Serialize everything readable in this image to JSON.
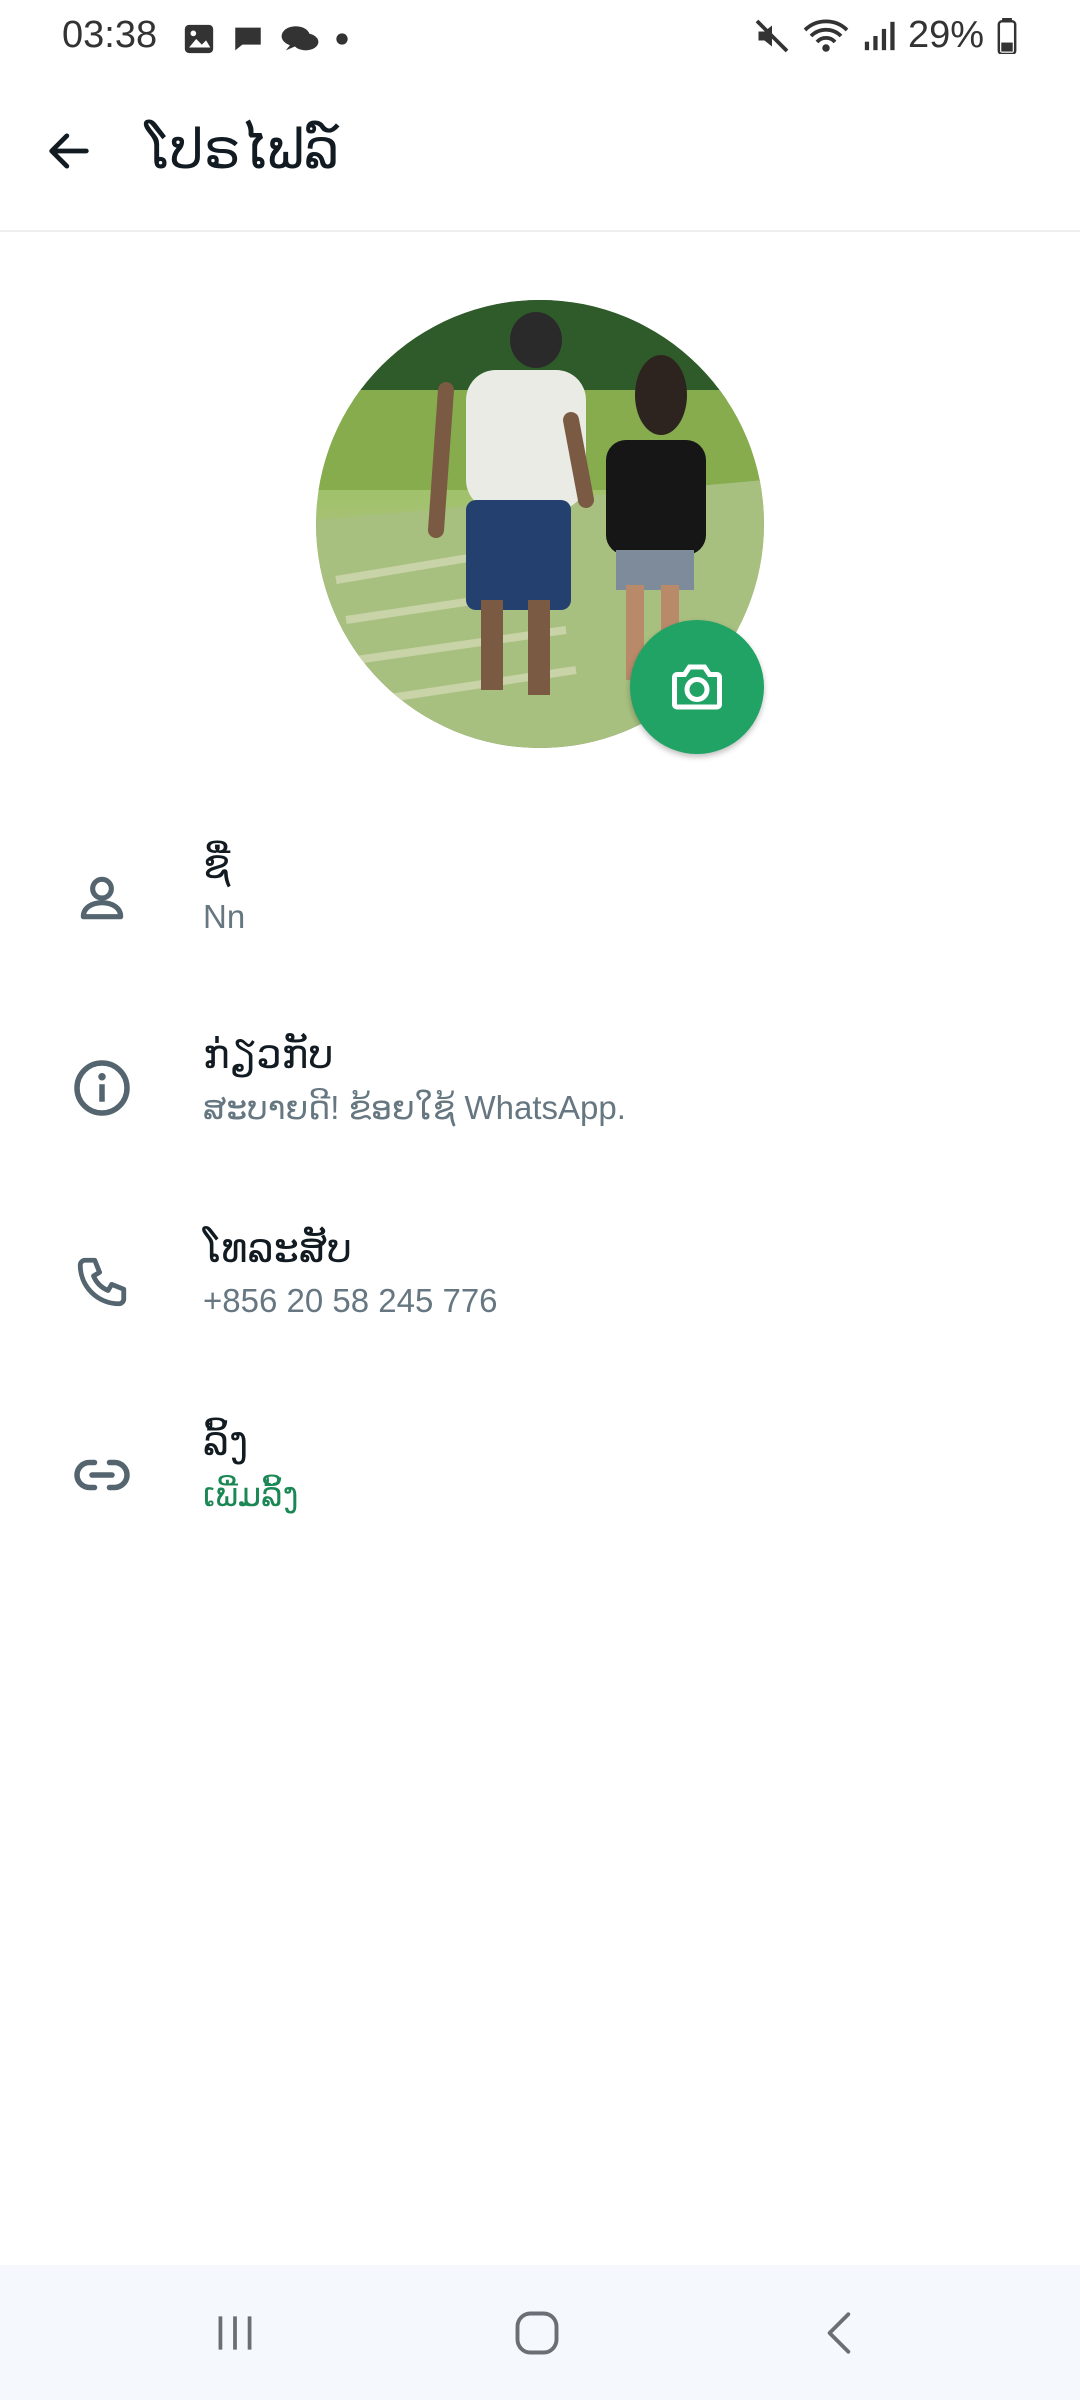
{
  "status_bar": {
    "time": "03:38",
    "battery_percent": "29%",
    "left_icons": [
      "gallery-icon",
      "message-icon",
      "chat-bubbles-icon",
      "dot-icon"
    ],
    "right_icons": [
      "mute-icon",
      "wifi-icon",
      "signal-icon",
      "battery-icon"
    ]
  },
  "app_bar": {
    "title": "ໂປຣໄຟລ໌",
    "back_icon": "arrow-left-icon"
  },
  "profile": {
    "avatar_alt": "profile-photo",
    "camera_icon": "camera-icon",
    "accent_color": "#21a366"
  },
  "rows": [
    {
      "icon": "person-icon",
      "label": "ຊື່",
      "value": "Nn"
    },
    {
      "icon": "info-icon",
      "label": "ກ່ຽວກັບ",
      "value": "ສະບາຍດີ! ຂ້ອຍໃຊ້ WhatsApp."
    },
    {
      "icon": "phone-icon",
      "label": "ໂທລະສັບ",
      "value": "+856 20 58 245 776"
    },
    {
      "icon": "link-icon",
      "label": "ລິ້ງ",
      "value": "ເພີ່ມລິ້ງ"
    }
  ],
  "nav_bar": {
    "items": [
      "recents-icon",
      "home-icon",
      "back-icon"
    ]
  }
}
